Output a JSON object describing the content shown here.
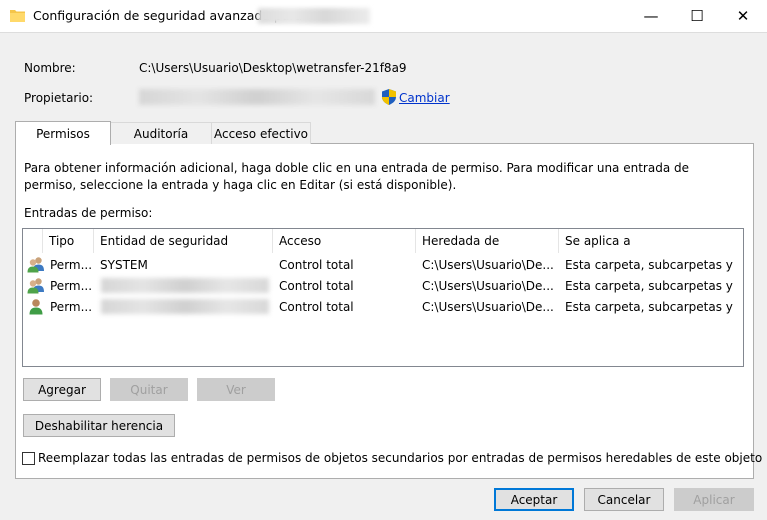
{
  "window": {
    "title": "Configuración de seguridad avanzada para",
    "minimize_glyph": "—",
    "maximize_glyph": "☐",
    "close_glyph": "✕"
  },
  "header": {
    "name_label": "Nombre:",
    "name_value": "C:\\Users\\Usuario\\Desktop\\wetransfer-21f8a9",
    "owner_label": "Propietario:",
    "change_link": "Cambiar"
  },
  "tabs": [
    {
      "label": "Permisos",
      "active": true
    },
    {
      "label": "Auditoría",
      "active": false
    },
    {
      "label": "Acceso efectivo",
      "active": false
    }
  ],
  "permissions": {
    "description": "Para obtener información adicional, haga doble clic en una entrada de permiso. Para modificar una entrada de permiso, seleccione la entrada y haga clic en Editar (si está disponible).",
    "entries_label": "Entradas de permiso:",
    "columns": [
      "Tipo",
      "Entidad de seguridad",
      "Acceso",
      "Heredada de",
      "Se aplica a"
    ],
    "rows": [
      {
        "icon": "group-users-icon",
        "type": "Perm...",
        "principal": "SYSTEM",
        "access": "Control total",
        "inherited": "C:\\Users\\Usuario\\De...",
        "applies": "Esta carpeta, subcarpetas y ..."
      },
      {
        "icon": "group-users-icon",
        "type": "Perm...",
        "principal": "",
        "access": "Control total",
        "inherited": "C:\\Users\\Usuario\\De...",
        "applies": "Esta carpeta, subcarpetas y ..."
      },
      {
        "icon": "single-user-icon",
        "type": "Perm...",
        "principal": "",
        "access": "Control total",
        "inherited": "C:\\Users\\Usuario\\De...",
        "applies": "Esta carpeta, subcarpetas y ..."
      }
    ],
    "buttons": {
      "add": "Agregar",
      "remove": "Quitar",
      "view": "Ver",
      "disable_inheritance": "Deshabilitar herencia"
    },
    "replace_checkbox_label": "Reemplazar todas las entradas de permisos de objetos secundarios por entradas de permisos heredables de este objeto",
    "replace_checkbox_checked": false
  },
  "footer": {
    "ok": "Aceptar",
    "cancel": "Cancelar",
    "apply": "Aplicar"
  }
}
